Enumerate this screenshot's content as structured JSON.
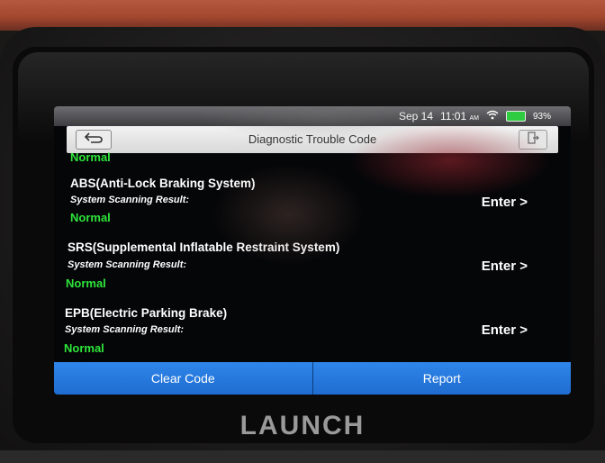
{
  "status_bar": {
    "date": "Sep 14",
    "time": "11:01",
    "ampm": "AM",
    "battery": "93%",
    "battery_color": "#2ecc40"
  },
  "header": {
    "title": "Diagnostic Trouble Code",
    "back_icon": "back-arrow-icon",
    "exit_icon": "exit-icon"
  },
  "top_partial_result": "Normal",
  "systems": [
    {
      "name": "ABS(Anti-Lock Braking System)",
      "label": "System Scanning Result:",
      "result": "Normal",
      "action": "Enter >"
    },
    {
      "name": "SRS(Supplemental Inflatable Restraint System)",
      "label": "System Scanning Result:",
      "result": "Normal",
      "action": "Enter >"
    },
    {
      "name": "EPB(Electric Parking Brake)",
      "label": "System Scanning Result:",
      "result": "Normal",
      "action": "Enter >"
    }
  ],
  "footer": {
    "clear_code": "Clear Code",
    "report": "Report",
    "button_color": "#2f86ea"
  },
  "device": {
    "brand": "LAUNCH"
  },
  "colors": {
    "normal_status": "#2ee43a",
    "accent_blue": "#2f86ea"
  }
}
